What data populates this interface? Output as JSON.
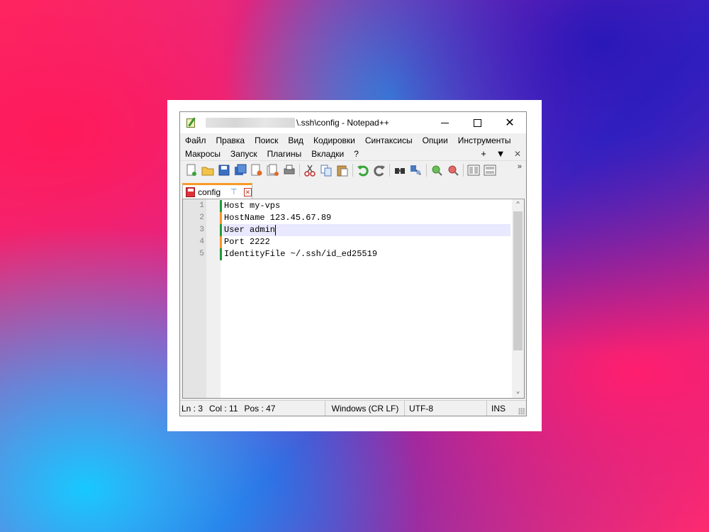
{
  "window": {
    "title_suffix": "\\.ssh\\config - Notepad++",
    "minimize_glyph": "—",
    "close_glyph": "✕"
  },
  "menu": {
    "row1": [
      "Файл",
      "Правка",
      "Поиск",
      "Вид",
      "Кодировки",
      "Синтаксисы",
      "Опции",
      "Инструменты"
    ],
    "row2": [
      "Макросы",
      "Запуск",
      "Плагины",
      "Вкладки",
      "?"
    ],
    "right_icons": [
      "+",
      "▼",
      "✕"
    ]
  },
  "toolbar": {
    "icons": [
      "new-file-icon",
      "open-file-icon",
      "save-icon",
      "save-all-icon",
      "close-icon",
      "close-all-icon",
      "print-icon",
      "cut-icon",
      "copy-icon",
      "paste-icon",
      "undo-icon",
      "redo-icon",
      "find-icon",
      "replace-icon",
      "zoom-in-icon",
      "zoom-out-icon",
      "sync-v-icon",
      "sync-h-icon"
    ],
    "overflow": "»"
  },
  "tab": {
    "label": "config",
    "pin_glyph": "⊤",
    "close_glyph": "✕"
  },
  "editor": {
    "lines": [
      {
        "num": "1",
        "text": "Host my-vps",
        "mark": "saved"
      },
      {
        "num": "2",
        "text": "HostName 123.45.67.89",
        "mark": "modified"
      },
      {
        "num": "3",
        "text": "User admin",
        "mark": "saved"
      },
      {
        "num": "4",
        "text": "Port 2222",
        "mark": "modified"
      },
      {
        "num": "5",
        "text": "IdentityFile ~/.ssh/id_ed25519",
        "mark": "saved"
      }
    ],
    "current_line": 3,
    "scroll_up": "⌃",
    "scroll_down": "⌄"
  },
  "colors": {
    "saved_mark": "#1f9c3a",
    "modified_mark": "#f5952a",
    "tab_accent": "#fa9a28"
  },
  "status": {
    "ln": "Ln : 3",
    "col": "Col : 11",
    "pos": "Pos : 47",
    "eol": "Windows (CR LF)",
    "encoding": "UTF-8",
    "mode": "INS"
  }
}
